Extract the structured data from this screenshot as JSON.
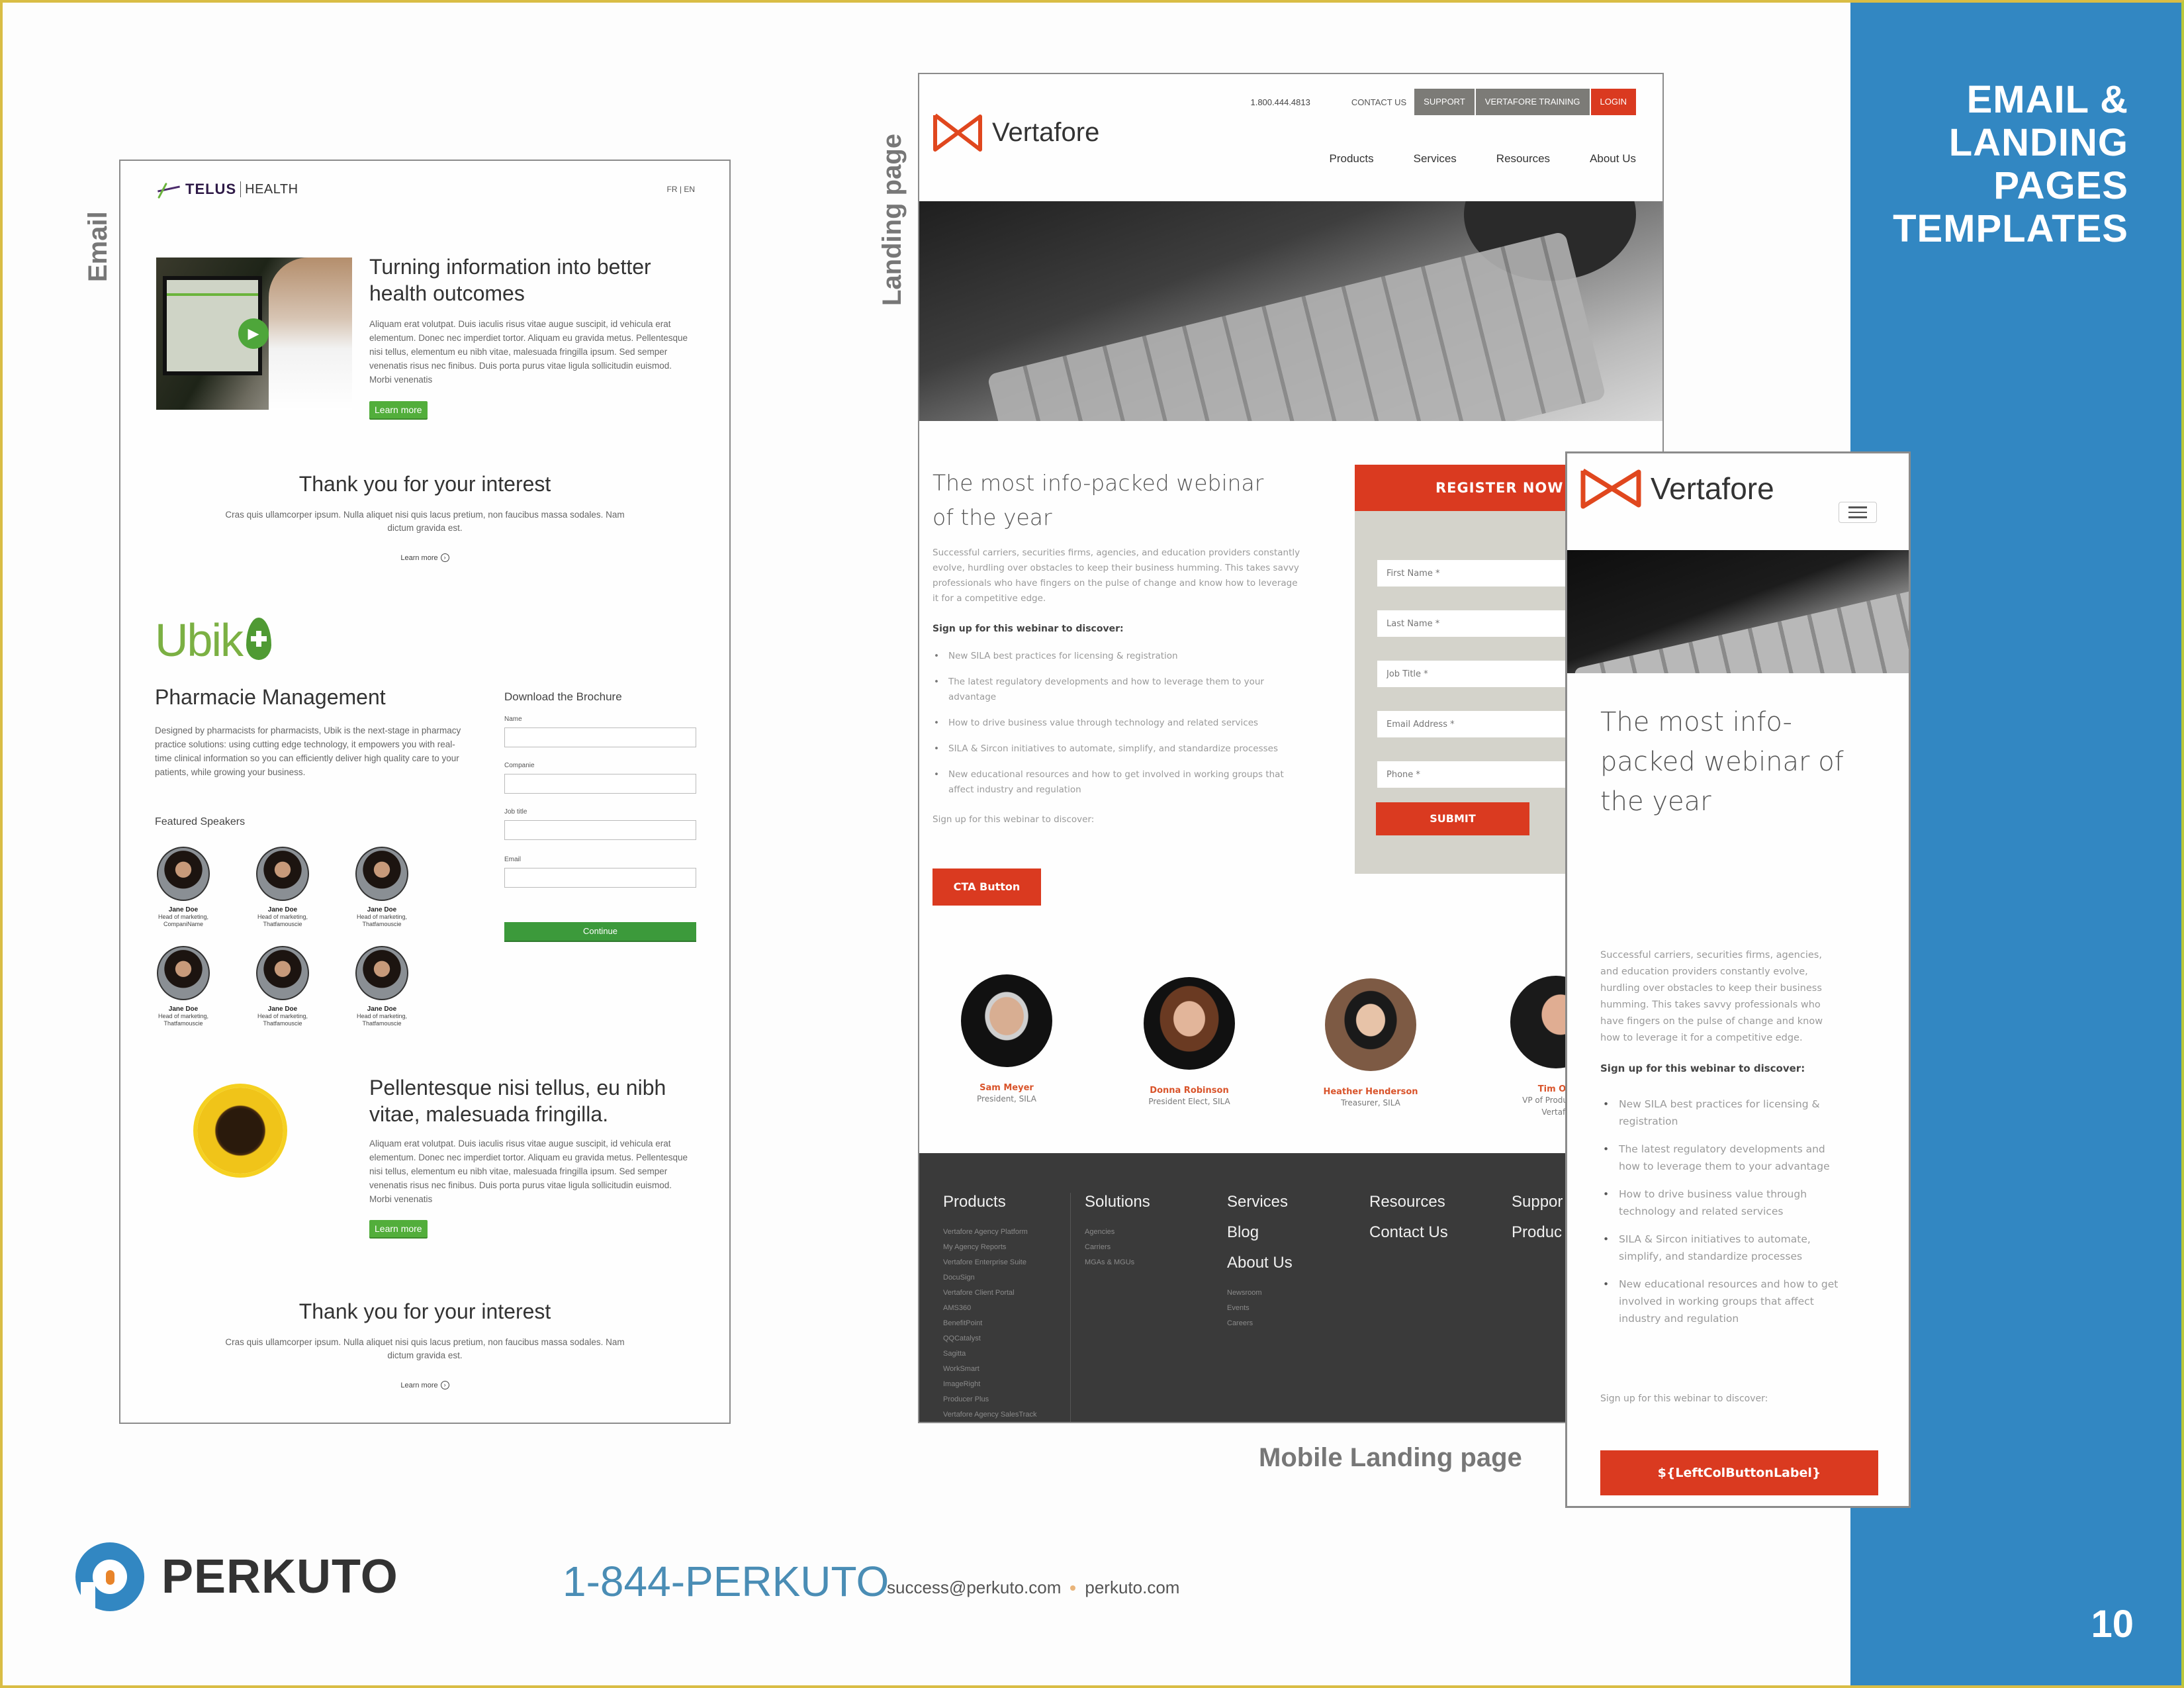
{
  "panel": {
    "title_lines": [
      "EMAIL &",
      "LANDING",
      "PAGES",
      "TEMPLATES"
    ],
    "page_number": "10",
    "accent_color": "#3287c2"
  },
  "labels": {
    "email": "Email",
    "landing": "Landing page",
    "mobile": "Mobile Landing page"
  },
  "email": {
    "brand": {
      "word": "TELUS",
      "sub": "HEALTH"
    },
    "lang_switch": "FR | EN",
    "hero": {
      "title": "Turning information into better health outcomes",
      "body": "Aliquam erat volutpat. Duis iaculis risus vitae augue suscipit, id vehicula erat elementum. Donec nec imperdiet tortor. Aliquam eu gravida metus. Pellentesque nisi tellus, elementum eu nibh vitae, malesuada fringilla ipsum. Sed semper venenatis risus nec finibus. Duis porta purus vitae ligula sollicitudin euismod. Morbi venenatis",
      "button": "Learn more",
      "play_icon": "▶"
    },
    "thank_you_1": {
      "title": "Thank you for your interest",
      "body": "Cras quis ullamcorper ipsum. Nulla aliquet nisi quis lacus pretium, non faucibus massa sodales. Nam dictum gravida est.",
      "link": "Learn more",
      "link_icon": "›"
    },
    "ubik": {
      "logo_word": "Ubik",
      "title": "Pharmacie Management",
      "body": "Designed by pharmacists for pharmacists, Ubik is the next-stage in pharmacy practice solutions: using cutting edge technology, it empowers you with real-time clinical information so you can efficiently deliver high quality care to your patients, while growing your business."
    },
    "brochure": {
      "title": "Download the Brochure",
      "fields": [
        {
          "label": "Name",
          "value": ""
        },
        {
          "label": "Companie",
          "value": ""
        },
        {
          "label": "Job title",
          "value": ""
        },
        {
          "label": "Email",
          "value": ""
        }
      ],
      "button": "Continue"
    },
    "speakers": {
      "title": "Featured Speakers",
      "items": [
        {
          "name": "Jane Doe",
          "role": "Head of marketing,",
          "company": "CompaniName"
        },
        {
          "name": "Jane Doe",
          "role": "Head of marketing,",
          "company": "Thatfamouscie"
        },
        {
          "name": "Jane Doe",
          "role": "Head of marketing,",
          "company": "Thatfamouscie"
        },
        {
          "name": "Jane Doe",
          "role": "Head of marketing,",
          "company": "Thatfamouscie"
        },
        {
          "name": "Jane Doe",
          "role": "Head of marketing,",
          "company": "Thatfamouscie"
        },
        {
          "name": "Jane Doe",
          "role": "Head of marketing,",
          "company": "Thatfamouscie"
        }
      ]
    },
    "sunflower": {
      "title": "Pellentesque nisi tellus, eu nibh vitae, malesuada fringilla.",
      "body": "Aliquam erat volutpat. Duis iaculis risus vitae augue suscipit, id vehicula erat elementum. Donec nec imperdiet tortor. Aliquam eu gravida metus. Pellentesque nisi tellus, elementum eu nibh vitae, malesuada fringilla ipsum. Sed semper venenatis risus nec finibus. Duis porta purus vitae ligula sollicitudin euismod. Morbi venenatis",
      "button": "Learn more"
    },
    "thank_you_2": {
      "title": "Thank you for your interest",
      "body": "Cras quis ullamcorper ipsum. Nulla aliquet nisi quis lacus pretium, non faucibus massa sodales. Nam dictum gravida est.",
      "link": "Learn more",
      "link_icon": "›"
    }
  },
  "landing": {
    "brand": "Vertafore",
    "topbar": {
      "phone": "1.800.444.4813",
      "contact": "CONTACT US",
      "support": "SUPPORT",
      "training": "VERTAFORE TRAINING",
      "login": "LOGIN"
    },
    "nav": [
      "Products",
      "Services",
      "Resources",
      "About Us"
    ],
    "title": "The most info-packed webinar of the year",
    "body": "Successful carriers, securities firms, agencies, and education providers constantly evolve, hurdling over obstacles to keep their business humming. This takes savvy professionals who have fingers on the pulse of change and know how to leverage it for a competitive edge.",
    "signup_bold": "Sign up for this webinar to discover:",
    "bullets": [
      "New SILA best practices for licensing & registration",
      "The latest regulatory developments and how to leverage them to your advantage",
      "How to drive business value through technology and related services",
      "SILA & Sircon initiatives to automate, simplify, and standardize processes",
      "New educational resources and how to get involved in working groups that affect industry and regulation"
    ],
    "signup_plain": "Sign up for this webinar to discover:",
    "cta": "CTA Button",
    "register": {
      "title": "REGISTER NOW",
      "placeholders": [
        "First Name *",
        "Last Name *",
        "Job Title *",
        "Email Address *",
        "Phone *"
      ],
      "submit": "SUBMIT"
    },
    "speakers": [
      {
        "name": "Sam Meyer",
        "role": "President, SILA"
      },
      {
        "name": "Donna Robinson",
        "role": "President Elect, SILA"
      },
      {
        "name": "Heather Henderson",
        "role": "Treasurer, SILA"
      },
      {
        "name": "Tim Ow",
        "role": "VP of Product Ma",
        "role2": "Vertafo"
      }
    ],
    "footer": {
      "products": {
        "title": "Products",
        "items": [
          "Vertafore Agency Platform",
          "My Agency Reports",
          "Vertafore Enterprise Suite",
          "DocuSign",
          "Vertafore Client Portal",
          "AMS360",
          "BenefitPoint",
          "QQCatalyst",
          "Sagitta",
          "WorkSmart",
          "ImageRight",
          "Producer Plus",
          "Vertafore Agency SalesTrack"
        ]
      },
      "solutions": {
        "title": "Solutions",
        "items": [
          "Agencies",
          "Carriers",
          "MGAs & MGUs"
        ]
      },
      "services": {
        "title": "Services",
        "extra": [
          "Blog",
          "About Us"
        ],
        "items": [
          "Newsroom",
          "Events",
          "Careers"
        ]
      },
      "resources": {
        "title": "Resources",
        "extra": [
          "Contact Us"
        ]
      },
      "support": {
        "title": "Suppor",
        "extra": [
          "Produc"
        ]
      }
    }
  },
  "mobile": {
    "brand": "Vertafore",
    "title": "The most info-packed webinar of the year",
    "body": "Successful carriers, securities firms, agencies, and education providers constantly evolve, hurdling over obstacles to keep their business humming. This takes savvy professionals who have fingers on the pulse of change and know how to leverage it for a competitive edge.",
    "signup_bold": "Sign up for this webinar to discover:",
    "bullets": [
      "New SILA best practices for licensing & registration",
      "The latest regulatory developments and how to leverage them to your advantage",
      "How to drive business value through technology and related services",
      "SILA & Sircon initiatives to automate, simplify, and standardize processes",
      "New educational resources and how to get involved in working groups that affect industry and regulation"
    ],
    "signup_plain": "Sign up for this webinar to discover:",
    "cta": "${LeftColButtonLabel}"
  },
  "brand_footer": {
    "company": "PERKUTO",
    "phone": "1-844-PERKUTO",
    "email": "success@perkuto.com",
    "website": "perkuto.com"
  }
}
